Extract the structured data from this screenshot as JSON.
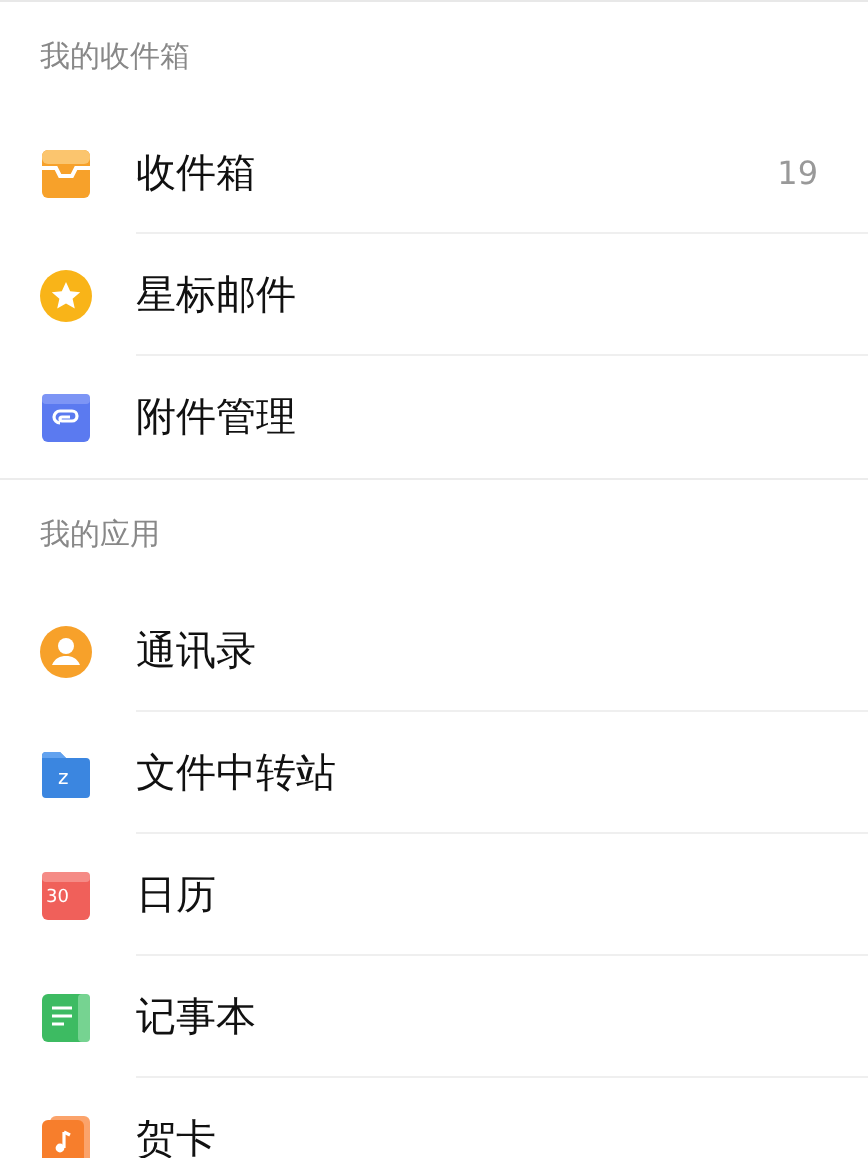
{
  "sections": [
    {
      "title": "我的收件箱",
      "items": [
        {
          "kind": "inbox",
          "label": "收件箱",
          "count": "19"
        },
        {
          "kind": "star",
          "label": "星标邮件"
        },
        {
          "kind": "attachment",
          "label": "附件管理"
        }
      ]
    },
    {
      "title": "我的应用",
      "items": [
        {
          "kind": "contacts",
          "label": "通讯录"
        },
        {
          "kind": "folder",
          "label": "文件中转站",
          "icon_label": "z"
        },
        {
          "kind": "calendar",
          "label": "日历",
          "icon_label": "30"
        },
        {
          "kind": "notes",
          "label": "记事本"
        },
        {
          "kind": "card",
          "label": "贺卡"
        }
      ]
    }
  ]
}
